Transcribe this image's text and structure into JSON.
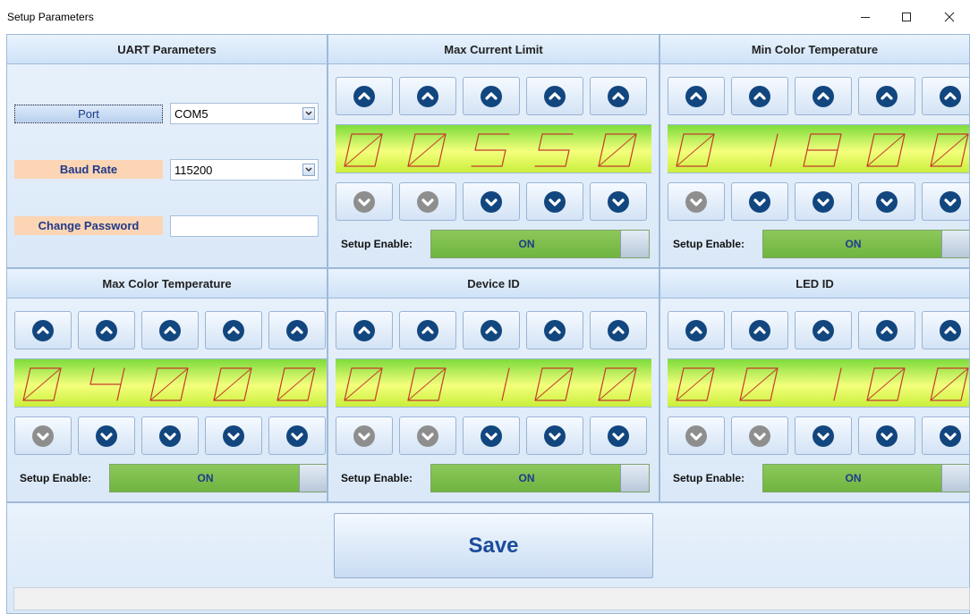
{
  "window": {
    "title": "Setup Parameters"
  },
  "icons": {
    "minimize": "minimize-icon",
    "maximize": "maximize-icon",
    "close": "close-icon",
    "up": "chevron-up-icon",
    "down": "chevron-down-icon",
    "dropdown": "dropdown-arrow-icon"
  },
  "colors": {
    "active_arrow": "#12467f",
    "disabled_arrow": "#8e8e8e",
    "segment": "#c43b2f",
    "toggle_on": "#7cbe4c",
    "label_peach": "#fcd5b4"
  },
  "uart": {
    "header": "UART Parameters",
    "port_label": "Port",
    "port_value": "COM5",
    "baud_label": "Baud Rate",
    "baud_value": "115200",
    "password_label": "Change Password",
    "password_value": ""
  },
  "panels": [
    {
      "title": "Max Current Limit",
      "digits": [
        "0",
        "0",
        "5",
        "5",
        "0"
      ],
      "up_enabled": [
        true,
        true,
        true,
        true,
        true
      ],
      "down_enabled": [
        false,
        false,
        true,
        true,
        true
      ],
      "setup_enable_label": "Setup Enable:",
      "toggle_label": "ON"
    },
    {
      "title": "Min Color Temperature",
      "digits": [
        "0",
        "1",
        "8",
        "0",
        "0"
      ],
      "up_enabled": [
        true,
        true,
        true,
        true,
        true
      ],
      "down_enabled": [
        false,
        true,
        true,
        true,
        true
      ],
      "setup_enable_label": "Setup Enable:",
      "toggle_label": "ON"
    },
    {
      "title": "Max Color Temperature",
      "digits": [
        "0",
        "4",
        "0",
        "0",
        "0"
      ],
      "up_enabled": [
        true,
        true,
        true,
        true,
        true
      ],
      "down_enabled": [
        false,
        true,
        true,
        true,
        true
      ],
      "setup_enable_label": "Setup Enable:",
      "toggle_label": "ON"
    },
    {
      "title": "Device ID",
      "digits": [
        "0",
        "0",
        "1",
        "0",
        "0"
      ],
      "up_enabled": [
        true,
        true,
        true,
        true,
        true
      ],
      "down_enabled": [
        false,
        false,
        true,
        true,
        true
      ],
      "setup_enable_label": "Setup Enable:",
      "toggle_label": "ON"
    },
    {
      "title": "LED ID",
      "digits": [
        "0",
        "0",
        "1",
        "0",
        "0"
      ],
      "up_enabled": [
        true,
        true,
        true,
        true,
        true
      ],
      "down_enabled": [
        false,
        false,
        true,
        true,
        true
      ],
      "setup_enable_label": "Setup Enable:",
      "toggle_label": "ON"
    }
  ],
  "save_label": "Save",
  "status_text": ""
}
